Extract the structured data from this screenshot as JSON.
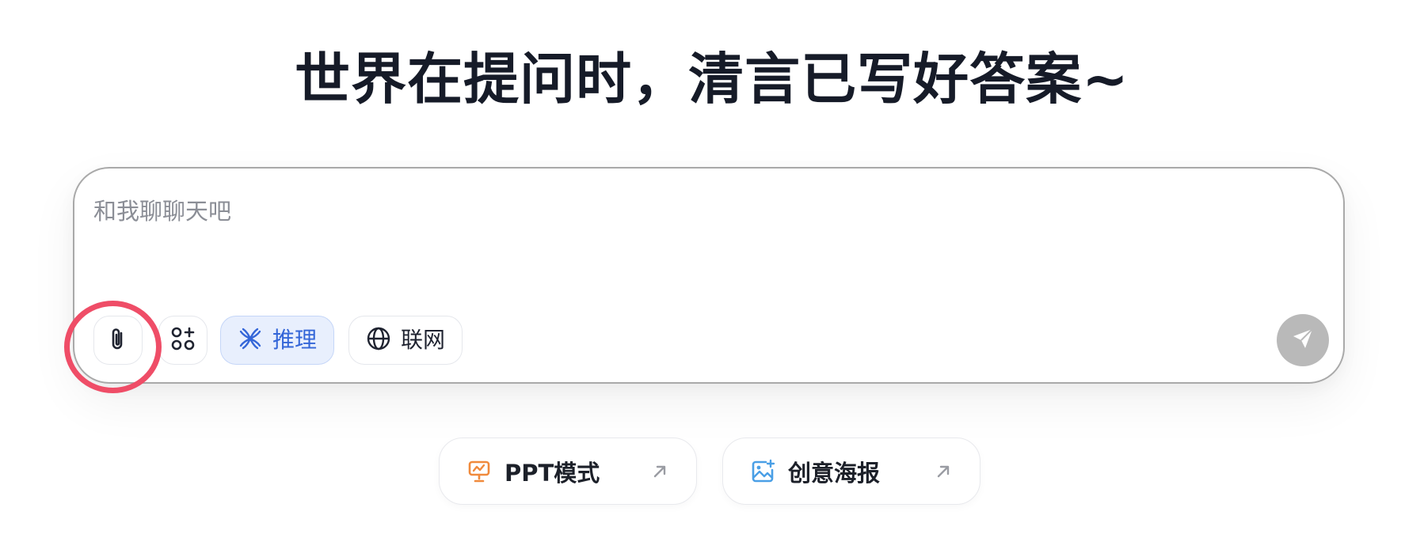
{
  "headline": "世界在提问时，清言已写好答案~",
  "chat": {
    "placeholder": "和我聊聊天吧",
    "value": "",
    "tools": [
      {
        "name": "attach",
        "icon": "paperclip-icon"
      },
      {
        "name": "apps",
        "icon": "apps-plus-icon"
      },
      {
        "name": "reason",
        "icon": "reasoning-knot-icon",
        "label": "推理",
        "active": true
      },
      {
        "name": "web",
        "icon": "globe-icon",
        "label": "联网",
        "active": false
      }
    ],
    "send_icon": "send-plane-icon"
  },
  "modes": [
    {
      "label": "PPT模式",
      "icon": "presentation-board-icon",
      "color": "#f08a3c"
    },
    {
      "label": "创意海报",
      "icon": "image-sparkle-icon",
      "color": "#4a9fe6"
    }
  ],
  "colors": {
    "active_tool_bg": "#e8effd",
    "active_tool_text": "#3466d8",
    "send_disabled": "#b9b9b9",
    "highlight_ring": "#ef4d67"
  }
}
